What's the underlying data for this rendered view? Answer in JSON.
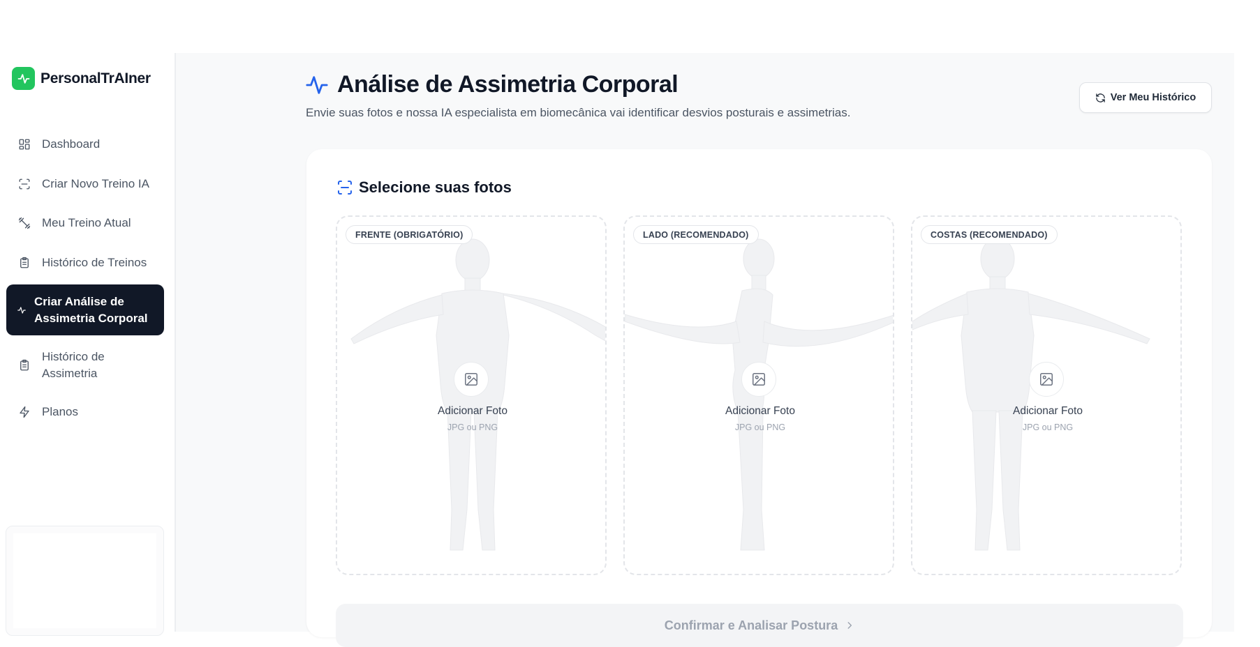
{
  "brand": {
    "name": "PersonalTrAIner",
    "accent": "#22c55e",
    "logo_icon": "activity-icon"
  },
  "sidebar": {
    "items": [
      {
        "label": "Dashboard",
        "icon": "dashboard-icon"
      },
      {
        "label": "Criar Novo Treino IA",
        "icon": "scan-icon"
      },
      {
        "label": "Meu Treino Atual",
        "icon": "dumbbell-icon"
      },
      {
        "label": "Histórico de Treinos",
        "icon": "clipboard-icon"
      },
      {
        "label": "Criar Análise de Assimetria Corporal",
        "icon": "activity-icon",
        "active": true
      },
      {
        "label": "Histórico de Assimetria",
        "icon": "clipboard-icon"
      },
      {
        "label": "Planos",
        "icon": "zap-icon"
      }
    ],
    "active_bg": "#111827"
  },
  "header": {
    "title": "Análise de Assimetria Corporal",
    "subtitle": "Envie suas fotos e nossa IA especialista em biomecânica vai identificar desvios posturais e assimetrias.",
    "history_button": "Ver Meu Histórico",
    "title_icon": "activity-icon",
    "accent": "#2563eb"
  },
  "upload": {
    "section_title": "Selecione suas fotos",
    "slots": [
      {
        "badge": "FRENTE (OBRIGATÓRIO)",
        "label": "Adicionar Foto",
        "hint": "JPG ou PNG",
        "view": "front"
      },
      {
        "badge": "LADO (RECOMENDADO)",
        "label": "Adicionar Foto",
        "hint": "JPG ou PNG",
        "view": "side"
      },
      {
        "badge": "COSTAS (RECOMENDADO)",
        "label": "Adicionar Foto",
        "hint": "JPG ou PNG",
        "view": "back"
      }
    ],
    "confirm_button": "Confirmar e Analisar Postura"
  }
}
